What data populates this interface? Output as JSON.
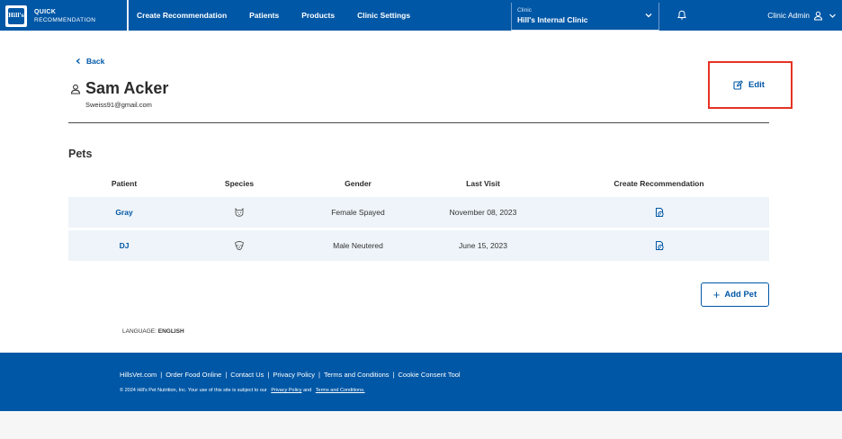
{
  "brand": {
    "logo_text": "Hill's",
    "line1": "QUICK",
    "line2": "RECOMMENDATION"
  },
  "nav": {
    "links": [
      "Create Recommendation",
      "Patients",
      "Products",
      "Clinic Settings"
    ],
    "clinic_label": "Clinic",
    "clinic_name": "Hill's Internal Clinic",
    "user_label": "Clinic Admin"
  },
  "main": {
    "back_label": "Back",
    "owner_name": "Sam Acker",
    "owner_email": "Sweiss91@gmail.com",
    "edit_label": "Edit",
    "pets_title": "Pets",
    "table": {
      "headers": [
        "Patient",
        "Species",
        "Gender",
        "Last Visit",
        "Create Recommendation"
      ],
      "rows": [
        {
          "patient": "Gray",
          "species": "cat-icon",
          "gender": "Female Spayed",
          "last_visit": "November 08, 2023"
        },
        {
          "patient": "DJ",
          "species": "dog-icon",
          "gender": "Male Neutered",
          "last_visit": "June 15, 2023"
        }
      ]
    },
    "add_pet_label": "Add Pet",
    "language_label": "LANGUAGE:",
    "language_value": "ENGLISH"
  },
  "footer": {
    "links": [
      "HillsVet.com",
      "Order Food Online",
      "Contact Us",
      "Privacy Policy",
      "Terms and Conditions",
      "Cookie Consent Tool"
    ],
    "copyright": "© 2024 Hill's Pet Nutrition, Inc. Your use of this site is subject to our",
    "privacy_link": "Privacy Policy",
    "and_text": "and",
    "terms_link": "Terms and Conditions."
  },
  "colors": {
    "brand_blue": "#0057a6",
    "row_bg": "#eef4f9",
    "highlight_red": "#e53323"
  }
}
